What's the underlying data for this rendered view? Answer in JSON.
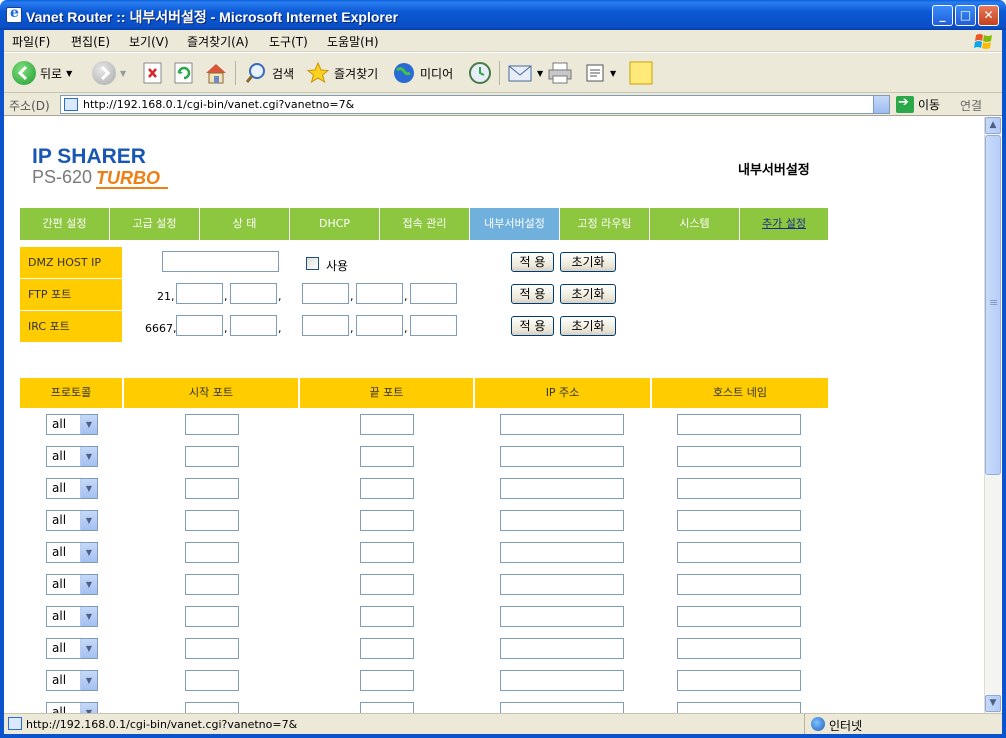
{
  "window": {
    "title": "Vanet Router :: 내부서버설정 - Microsoft Internet Explorer",
    "minimize": "_",
    "maximize": "□",
    "close": "✕"
  },
  "menu": [
    "파일(F)",
    "편집(E)",
    "보기(V)",
    "즐겨찾기(A)",
    "도구(T)",
    "도움말(H)"
  ],
  "toolbar": {
    "back": "뒤로",
    "search": "검색",
    "favorites": "즐겨찾기",
    "media": "미디어"
  },
  "address": {
    "label": "주소(D)",
    "url": "http://192.168.0.1/cgi-bin/vanet.cgi?vanetno=7&",
    "go": "이동",
    "links": "연결"
  },
  "logo": {
    "ip_sharer": "IP SHARER",
    "model": "PS-620",
    "turbo": "TURBO"
  },
  "page_title": "내부서버설정",
  "nav_tabs": [
    {
      "label": "간편 설정"
    },
    {
      "label": "고급 설정"
    },
    {
      "label": "상 태"
    },
    {
      "label": "DHCP"
    },
    {
      "label": "접속 관리"
    },
    {
      "label": "내부서버설정",
      "active": true
    },
    {
      "label": "고정 라우팅"
    },
    {
      "label": "시스템"
    },
    {
      "label": "추가 설정",
      "link": true
    }
  ],
  "settings": {
    "dmz": {
      "label": "DMZ HOST IP",
      "use_label": "사용",
      "use_checked": false
    },
    "ftp": {
      "label": "FTP 포트",
      "prefix": "21,"
    },
    "irc": {
      "label": "IRC 포트",
      "prefix": "6667,"
    },
    "apply": "적 용",
    "reset": "초기화"
  },
  "table": {
    "headers": [
      "프로토콜",
      "시작 포트",
      "끝 포트",
      "IP 주소",
      "호스트 네임"
    ],
    "protocol_default": "all",
    "row_count": 10
  },
  "status": {
    "text": "http://192.168.0.1/cgi-bin/vanet.cgi?vanetno=7&",
    "zone": "인터넷"
  },
  "colors": {
    "nav_green": "#8dc63f",
    "nav_active_blue": "#6fb0dc",
    "header_yellow": "#ffcc00",
    "title_bar_blue": "#0b58d4"
  }
}
